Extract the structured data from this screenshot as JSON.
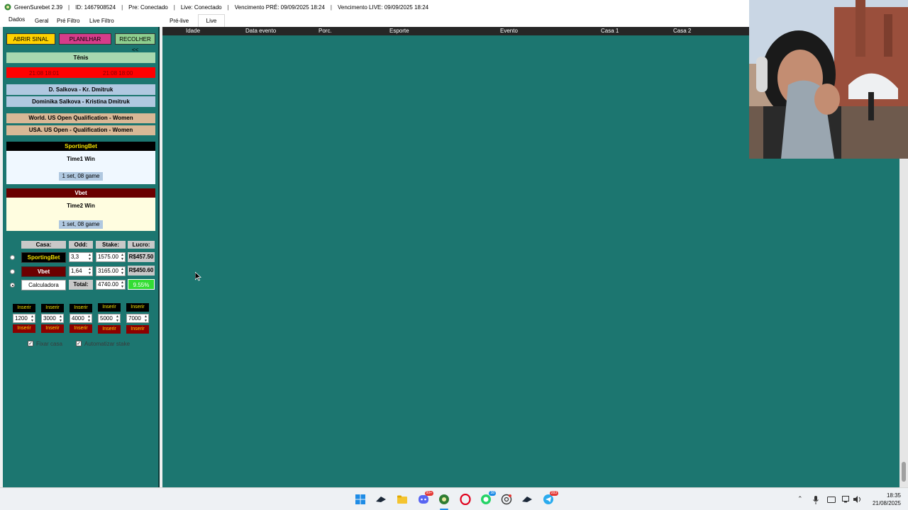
{
  "titlebar": {
    "app": "GreenSurebet 2.39",
    "id": "ID: 1467908524",
    "pre": "Pre: Conectado",
    "live": "Live: Conectado",
    "venc_pre": "Vencimento PRÉ: 09/09/2025 18:24",
    "venc_live": "Vencimento LIVE: 09/09/2025 18:24",
    "sep": "|"
  },
  "left_tabs": [
    "Dados",
    "Geral",
    "Pré Filtro",
    "Live Filtro"
  ],
  "right_tabs": [
    "Pré-live",
    "Live"
  ],
  "buttons": {
    "abrir": "ABRIR SINAL",
    "planilhar": "PLANILHAR",
    "recolher": "RECOLHER <<"
  },
  "event": {
    "sport": "Tênis",
    "time1": "21:08 18:01",
    "time2": "21:08 18:00",
    "name_short": "D. Salkova - Kr. Dmitruk",
    "name_full": "Dominika Salkova - Kristina Dmitruk",
    "league1": "World. US Open Qualification - Women",
    "league2": "USA. US Open - Qualification - Women"
  },
  "bet1": {
    "house": "SportingBet",
    "market": "Time1 Win",
    "period": "1 set, 08 game"
  },
  "bet2": {
    "house": "Vbet",
    "market": "Time2 Win",
    "period": "1 set, 08 game"
  },
  "calc": {
    "headers": [
      "Casa:",
      "Odd:",
      "Stake:",
      "Lucro:"
    ],
    "rows": [
      {
        "house": "SportingBet",
        "odd": "3,3",
        "stake": "1575.00",
        "lucro": "R$457.50"
      },
      {
        "house": "Vbet",
        "odd": "1,64",
        "stake": "3165.00",
        "lucro": "R$450.60"
      },
      {
        "house": "Calculadora",
        "odd": "Total:",
        "stake": "4740.00",
        "lucro": "9.55%"
      }
    ]
  },
  "quick": {
    "label": "Inserir",
    "values": [
      "1200",
      "3000",
      "4000",
      "5000",
      "7000"
    ]
  },
  "options": {
    "fixar": "Fixar casa",
    "auto": "Automatizar stake"
  },
  "table_headers": [
    "Idade",
    "Data evento",
    "Porc.",
    "Esporte",
    "Evento",
    "Casa 1",
    "Casa 2"
  ],
  "clock": {
    "time": "18:35",
    "date": "21/08/2025"
  },
  "taskbar_badges": {
    "discord": "99+",
    "whatsapp": "38",
    "telegram": "283"
  },
  "colors": {
    "teal": "#1c7670",
    "sportingbet_bg": "#000000",
    "sportingbet_fg": "#f2e000",
    "vbet_bg": "#6b0000",
    "alert_red": "#ff0000",
    "lucro_green": "#33dd33"
  }
}
